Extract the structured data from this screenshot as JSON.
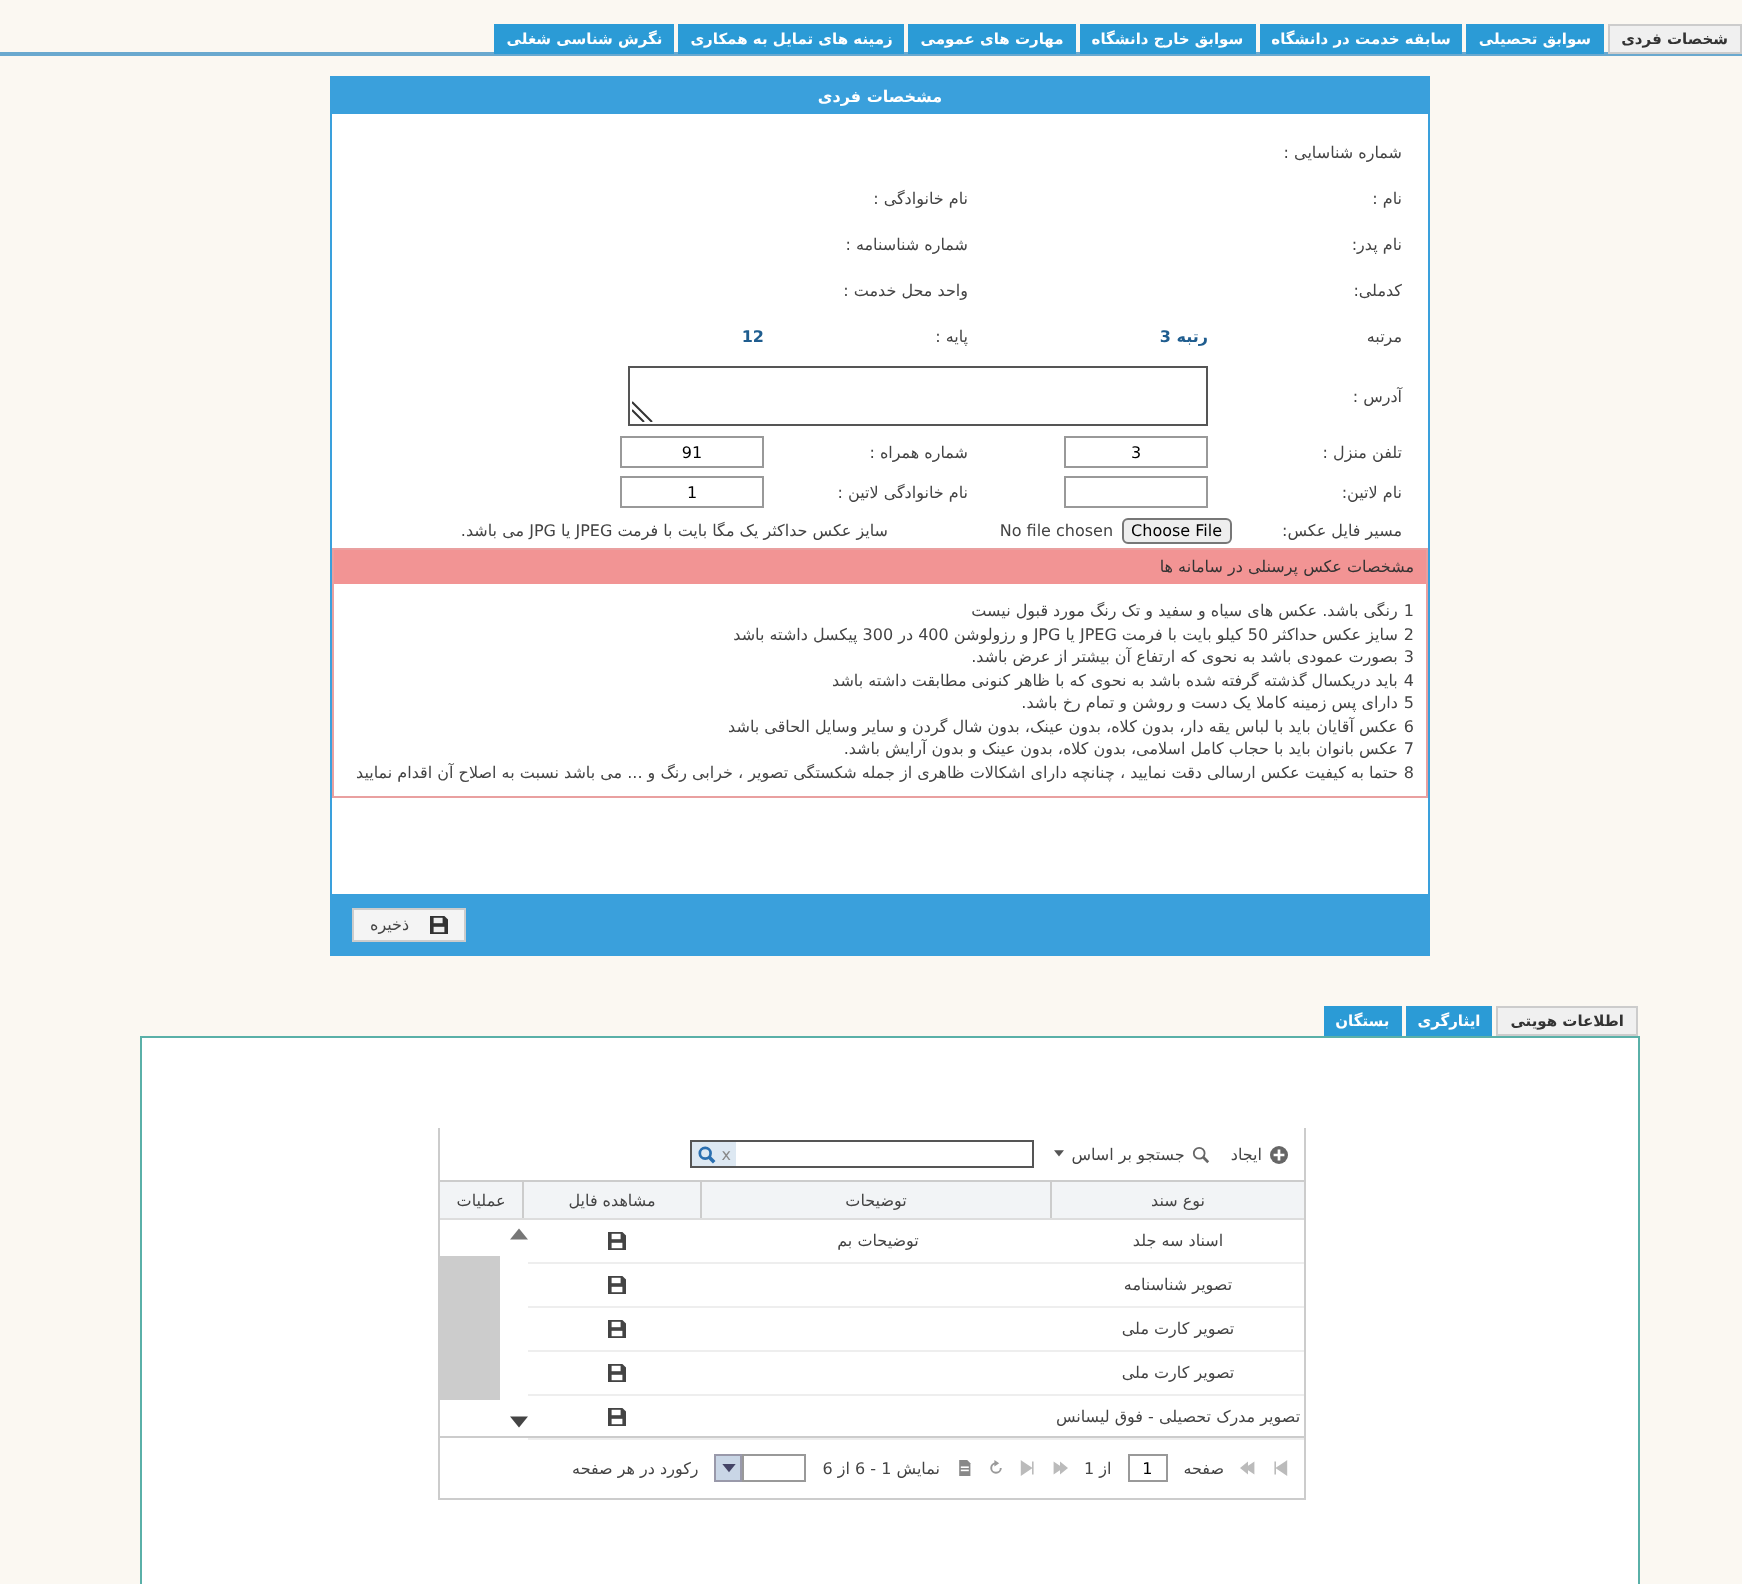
{
  "top_tabs": [
    {
      "label": "شخصات فردی",
      "selected": true
    },
    {
      "label": "سوابق تحصیلی",
      "selected": false
    },
    {
      "label": "سابقه خدمت در دانشگاه",
      "selected": false
    },
    {
      "label": "سوابق خارج دانشگاه",
      "selected": false
    },
    {
      "label": "مهارت های عمومی",
      "selected": false
    },
    {
      "label": "زمینه های تمایل به همکاری",
      "selected": false
    },
    {
      "label": "نگرش شناسی شغلی",
      "selected": false
    }
  ],
  "panel": {
    "title": "مشخصات فردی",
    "rows": [
      [
        {
          "label": "شماره شناسایی :",
          "kind": "label"
        }
      ],
      [
        {
          "label": "نام :",
          "kind": "label"
        },
        {
          "label": "نام خانوادگی :",
          "kind": "label"
        }
      ],
      [
        {
          "label": "نام پدر:",
          "kind": "label"
        },
        {
          "label": "شماره شناسنامه :",
          "kind": "label"
        }
      ],
      [
        {
          "label": "کدملی:",
          "kind": "label"
        },
        {
          "label": "واحد محل خدمت :",
          "kind": "label"
        }
      ],
      [
        {
          "label": "مرتبه",
          "kind": "text",
          "value": "رتبه 3"
        },
        {
          "label": "پایه :",
          "kind": "text",
          "value": "12"
        }
      ],
      [
        {
          "label": "آدرس :",
          "kind": "textarea"
        }
      ],
      [
        {
          "label": "تلفن منزل :",
          "kind": "input",
          "value": "3"
        },
        {
          "label": "شماره همراه :",
          "kind": "input",
          "value": "91"
        }
      ],
      [
        {
          "label": "نام لاتین:",
          "kind": "input"
        },
        {
          "label": "نام خانوادگی لاتین :",
          "kind": "input",
          "value": "1"
        }
      ]
    ],
    "file": {
      "label": "مسیر فایل عکس:",
      "button": "Choose File",
      "status": "No file chosen",
      "note": "سایز عکس حداکثر یک مگا بایت با فرمت JPEG یا JPG می باشد."
    },
    "rules_title": "مشخصات عکس پرسنلی در سامانه ها",
    "rules": [
      {
        "number": "1",
        "text": "رنگی باشد. عکس های سیاه و سفید و تک رنگ مورد قبول نیست"
      },
      {
        "number": "2",
        "text": "سایز عکس حداکثر 50 کیلو بایت با فرمت JPEG یا JPG و رزولوشن 400 در 300 پیکسل داشته باشد"
      },
      {
        "number": "3",
        "text": "بصورت عمودی باشد به نحوی که ارتفاع آن بیشتر از عرض باشد."
      },
      {
        "number": "4",
        "text": "باید دریکسال گذشته گرفته شده باشد به نحوی که با ظاهر کنونی مطابقت داشته باشد"
      },
      {
        "number": "5",
        "text": "دارای پس زمینه کاملا یک دست و روشن و تمام رخ باشد."
      },
      {
        "number": "6",
        "text": "عکس آقایان باید با لباس یقه دار، بدون کلاه، بدون عینک، بدون شال گردن و سایر وسایل الحاقی باشد"
      },
      {
        "number": "7",
        "text": "عکس بانوان باید با حجاب کامل اسلامی، بدون کلاه، بدون عینک و بدون آرایش باشد."
      },
      {
        "number": "8",
        "text": "حتما به کیفیت عکس ارسالی دقت نمایید ، چنانچه دارای اشکالات ظاهری از جمله شکستگی تصویر ، خرابی رنگ و ... می باشد نسبت به اصلاح آن اقدام نمایید"
      }
    ],
    "save_button": "ذخیره"
  },
  "bottom_tabs": [
    {
      "label": "اطلاعات هویتی",
      "selected": true
    },
    {
      "label": "ایثارگری",
      "selected": false
    },
    {
      "label": "بستگان",
      "selected": false
    }
  ],
  "grid": {
    "create": "ایجاد",
    "search_by": "جستجو بر اساس",
    "clear": "x",
    "columns": [
      "نوع سند",
      "توضیحات",
      "مشاهده فایل",
      "عملیات"
    ],
    "rows": [
      {
        "type": "اسناد سه جلد",
        "description": "توضیحات بم"
      },
      {
        "type": "تصویر شناسنامه"
      },
      {
        "type": "تصویر کارت ملی"
      },
      {
        "type": "تصویر کارت ملی"
      },
      {
        "type": "تصویر مدرک تحصیلی - فوق لیسانس"
      }
    ],
    "pager": {
      "page_label": "صفحه",
      "page": "1",
      "of": "از 1",
      "showing": "نمایش 1 - 6 از 6",
      "per_page": "رکورد در هر صفحه"
    }
  }
}
